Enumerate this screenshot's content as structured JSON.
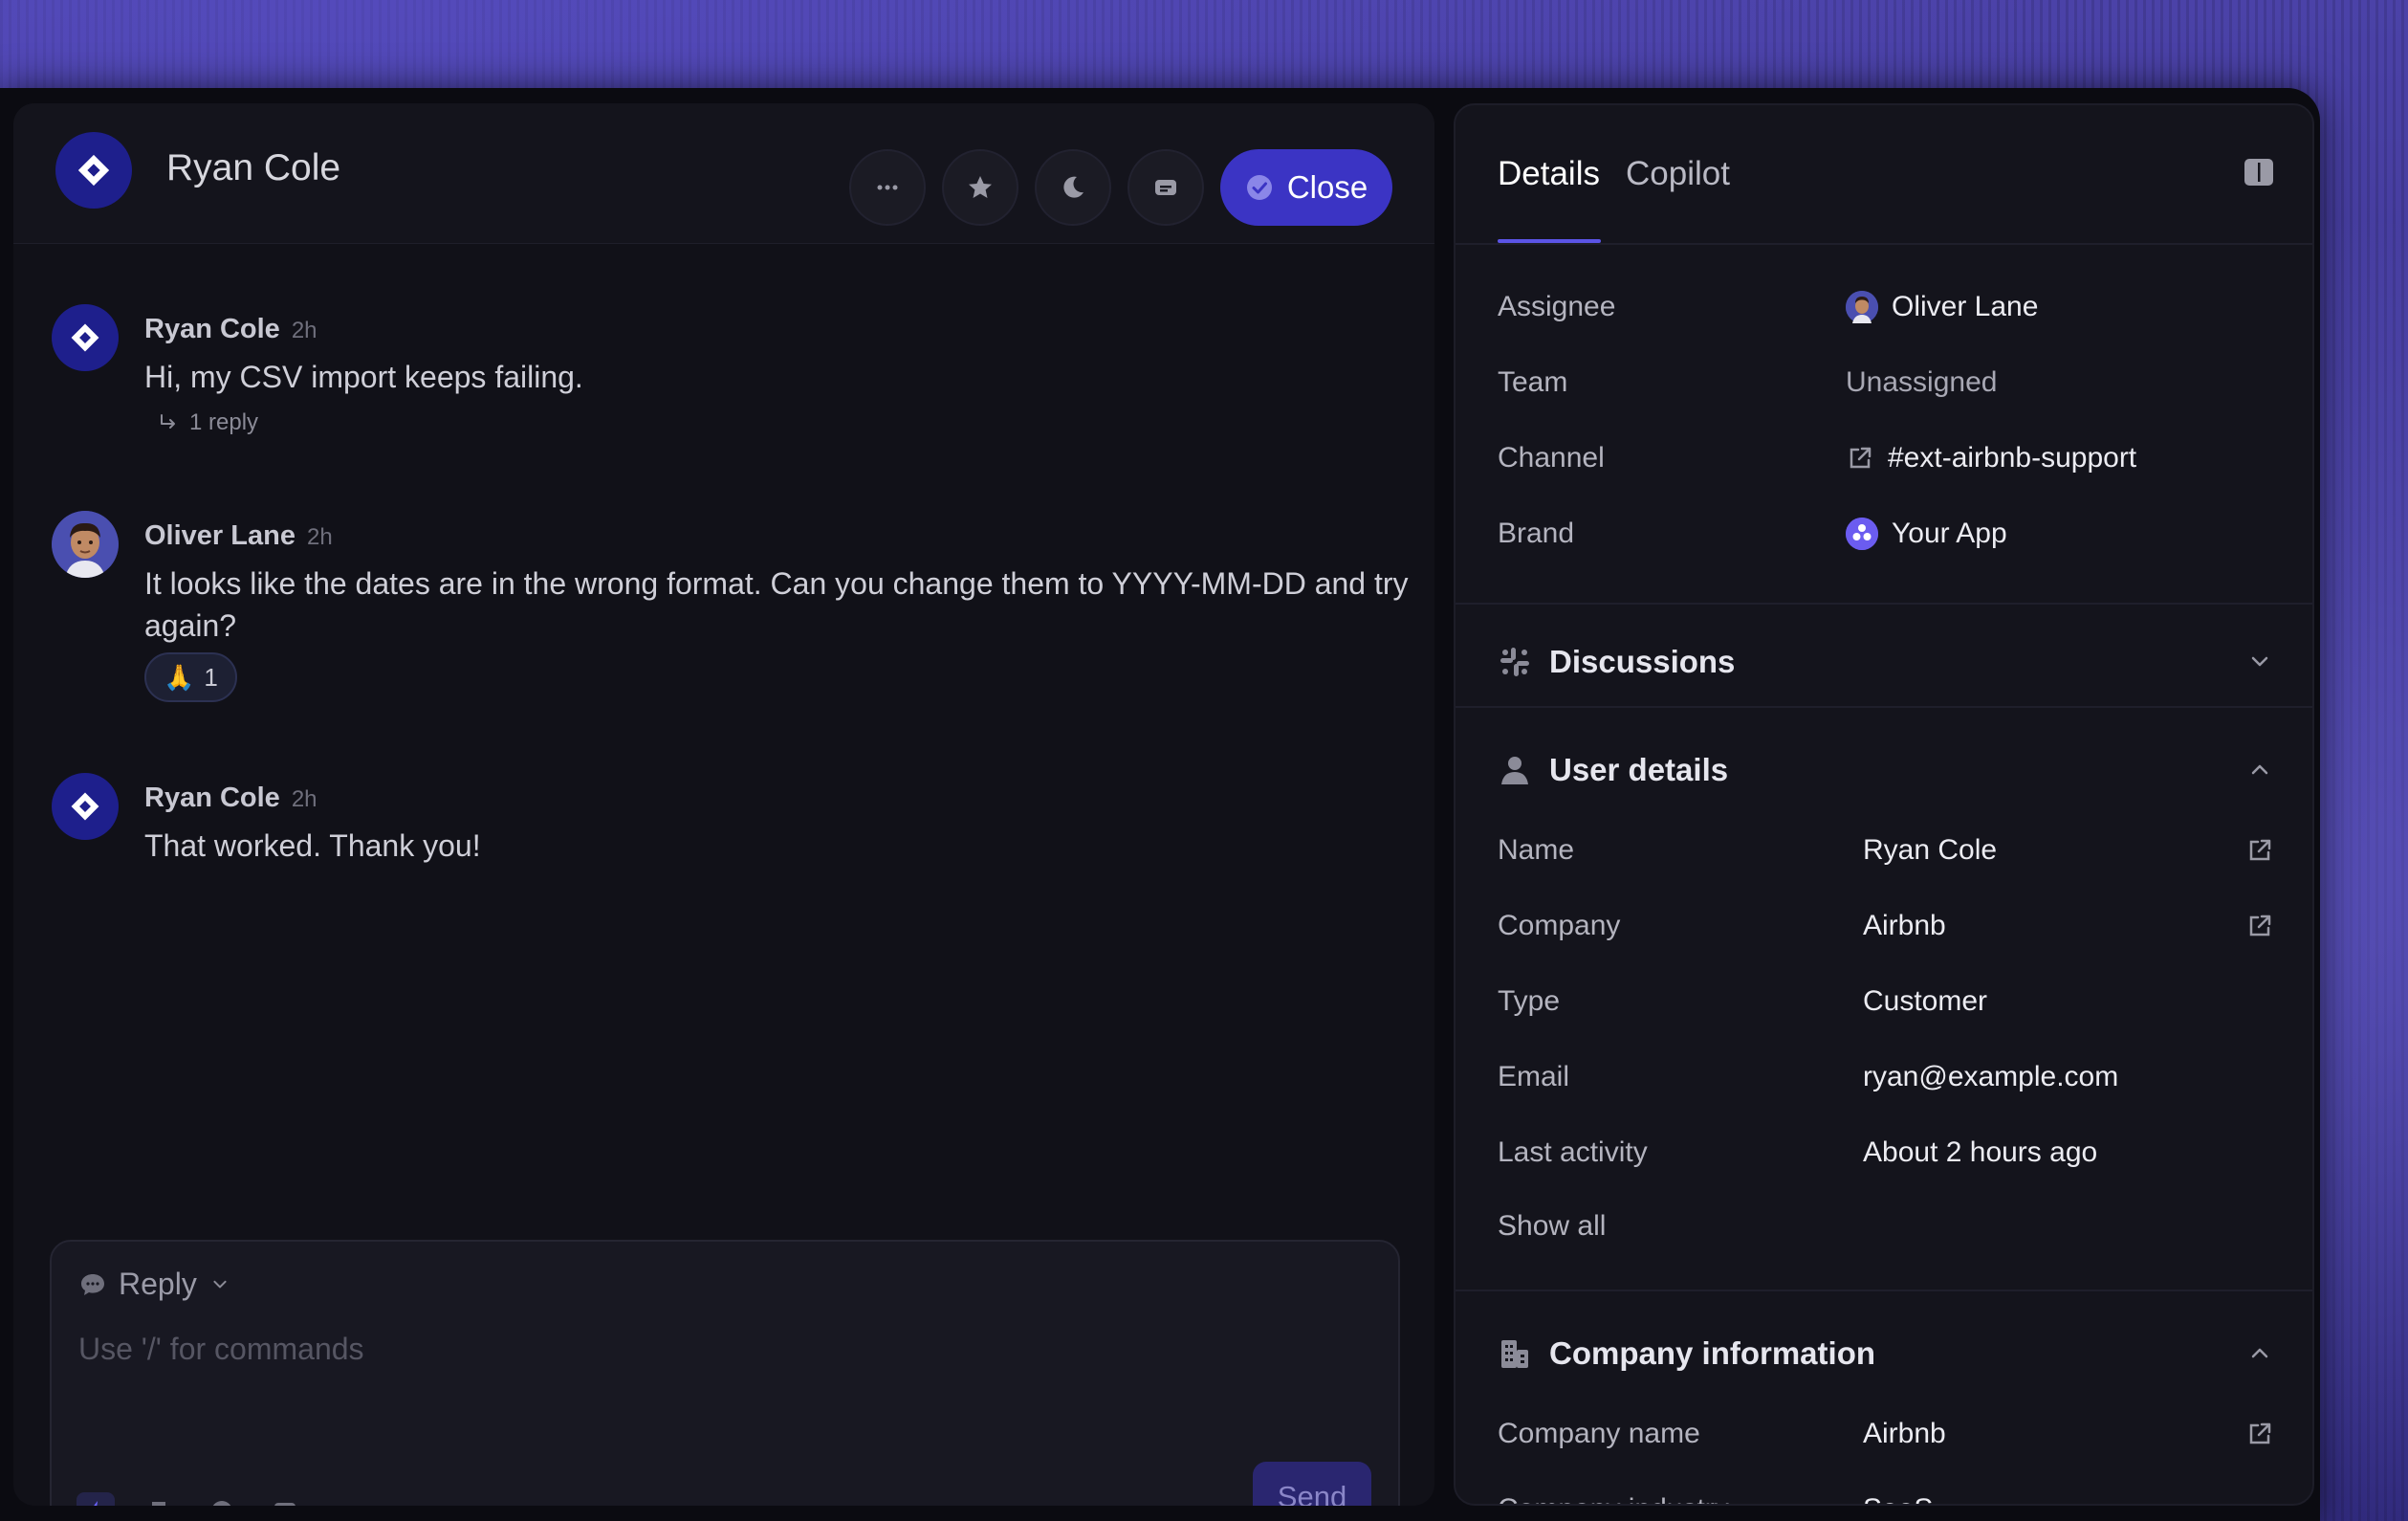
{
  "conversation": {
    "title": "Ryan Cole",
    "close_label": "Close",
    "messages": [
      {
        "author": "Ryan Cole",
        "time": "2h",
        "text": "Hi, my CSV import keeps failing.",
        "reply_count": "1 reply"
      },
      {
        "author": "Oliver Lane",
        "time": "2h",
        "text": "It looks like the dates are in the wrong format. Can you change them to YYYY-MM-DD and try again?",
        "reaction_emoji": "🙏",
        "reaction_count": "1"
      },
      {
        "author": "Ryan Cole",
        "time": "2h",
        "text": "That worked. Thank you!"
      }
    ]
  },
  "composer": {
    "mode_label": "Reply",
    "placeholder": "Use '/' for commands",
    "send_label": "Send"
  },
  "details": {
    "tabs": [
      "Details",
      "Copilot"
    ],
    "fields": {
      "assignee_label": "Assignee",
      "assignee_value": "Oliver Lane",
      "team_label": "Team",
      "team_value": "Unassigned",
      "channel_label": "Channel",
      "channel_value": "#ext-airbnb-support",
      "brand_label": "Brand",
      "brand_value": "Your App"
    },
    "discussions_title": "Discussions",
    "user_details": {
      "title": "User details",
      "rows": [
        {
          "label": "Name",
          "value": "Ryan Cole"
        },
        {
          "label": "Company",
          "value": "Airbnb"
        },
        {
          "label": "Type",
          "value": "Customer"
        },
        {
          "label": "Email",
          "value": "ryan@example.com"
        },
        {
          "label": "Last activity",
          "value": "About 2 hours ago"
        }
      ],
      "show_all": "Show all"
    },
    "company_info": {
      "title": "Company information",
      "rows": [
        {
          "label": "Company name",
          "value": "Airbnb"
        },
        {
          "label": "Company industry",
          "value": "SaaS"
        }
      ]
    }
  },
  "colors": {
    "accent": "#3b34c4",
    "brand_avatar": "#1e1f8c",
    "tab_underline": "#5b54e6"
  }
}
